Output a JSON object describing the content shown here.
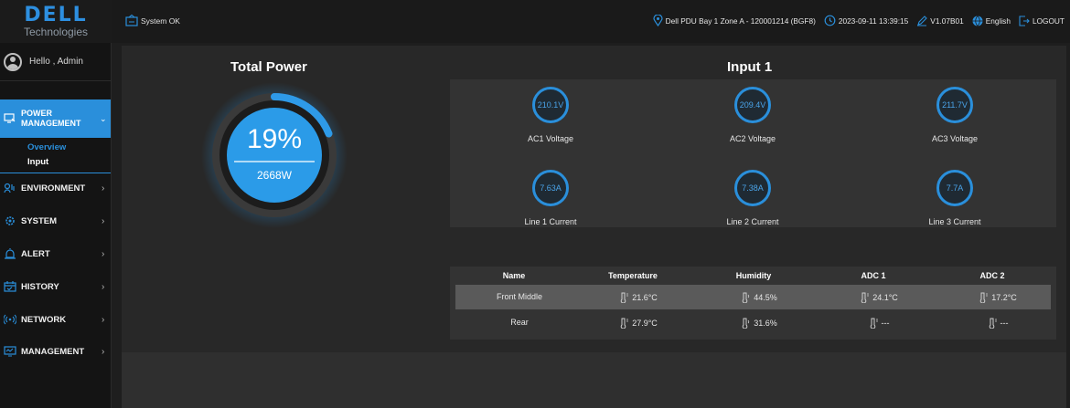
{
  "brand": {
    "name": "DELL",
    "sub": "Technologies"
  },
  "user": {
    "greeting": "Hello , Admin"
  },
  "sidebar": {
    "active": {
      "label": "POWER MANAGEMENT",
      "subitems": [
        "Overview",
        "Input"
      ]
    },
    "items": [
      {
        "label": "ENVIRONMENT",
        "icon": "environment-icon"
      },
      {
        "label": "SYSTEM",
        "icon": "gear-icon"
      },
      {
        "label": "ALERT",
        "icon": "alert-icon"
      },
      {
        "label": "HISTORY",
        "icon": "calendar-icon"
      },
      {
        "label": "NETWORK",
        "icon": "wireless-icon"
      },
      {
        "label": "MANAGEMENT",
        "icon": "monitor-icon"
      }
    ]
  },
  "topbar": {
    "status": "System OK",
    "location": "Dell PDU Bay 1 Zone A - 120001214 (BGF8)",
    "datetime": "2023-09-11 13:39:15",
    "version": "V1.07B01",
    "language": "English",
    "logout": "LOGOUT"
  },
  "total_power": {
    "title": "Total Power",
    "percent": "19%",
    "watts": "2668W",
    "level": 0.19
  },
  "input": {
    "title": "Input 1",
    "meters": [
      {
        "value": "210.1V",
        "label": "AC1 Voltage"
      },
      {
        "value": "209.4V",
        "label": "AC2 Voltage"
      },
      {
        "value": "211.7V",
        "label": "AC3 Voltage"
      },
      {
        "value": "7.63A",
        "label": "Line 1 Current"
      },
      {
        "value": "7.38A",
        "label": "Line 2 Current"
      },
      {
        "value": "7.7A",
        "label": "Line 3 Current"
      }
    ]
  },
  "sensors": {
    "columns": [
      "Name",
      "Temperature",
      "Humidity",
      "ADC 1",
      "ADC 2"
    ],
    "rows": [
      {
        "name": "Front Middle",
        "temperature": "21.6°C",
        "humidity": "44.5%",
        "adc1": "24.1°C",
        "adc2": "17.2°C"
      },
      {
        "name": "Rear",
        "temperature": "27.9°C",
        "humidity": "31.6%",
        "adc1": "---",
        "adc2": "---"
      }
    ]
  },
  "colors": {
    "accent": "#2a8fdb",
    "sidebar": "#141414",
    "panel": "#333333"
  }
}
